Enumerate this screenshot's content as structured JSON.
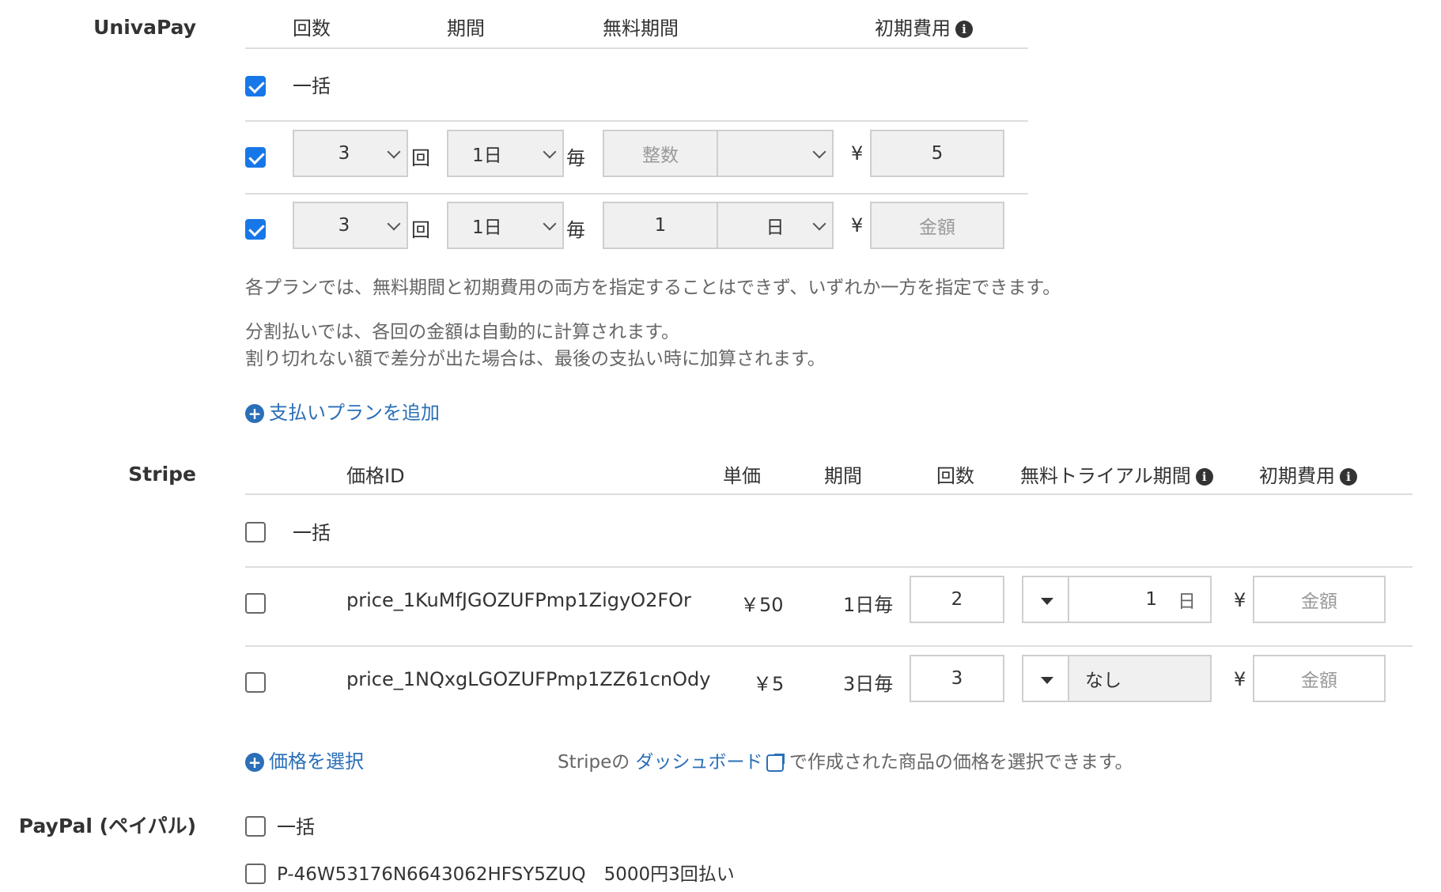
{
  "univapay": {
    "label": "UnivaPay",
    "headers": {
      "count": "回数",
      "period": "期間",
      "free_period": "無料期間",
      "initial_fee": "初期費用"
    },
    "lump_sum_label": "一括",
    "rows": [
      {
        "count": "3",
        "count_unit": "回",
        "period": "1日",
        "period_unit": "毎",
        "free_value_placeholder": "整数",
        "free_unit": "",
        "currency": "¥",
        "initial_fee": "5",
        "initial_placeholder": "金額"
      },
      {
        "count": "3",
        "count_unit": "回",
        "period": "1日",
        "period_unit": "毎",
        "free_value": "1",
        "free_unit": "日",
        "currency": "¥",
        "initial_fee": "",
        "initial_placeholder": "金額"
      }
    ],
    "note1": "各プランでは、無料期間と初期費用の両方を指定することはできず、いずれか一方を指定できます。",
    "note2": "分割払いでは、各回の金額は自動的に計算されます。",
    "note3": "割り切れない額で差分が出た場合は、最後の支払い時に加算されます。",
    "add_plan": "支払いプランを追加"
  },
  "stripe": {
    "label": "Stripe",
    "headers": {
      "price_id": "価格ID",
      "unit_price": "単価",
      "period": "期間",
      "count": "回数",
      "free_trial": "無料トライアル期間",
      "initial_fee": "初期費用"
    },
    "lump_sum_label": "一括",
    "rows": [
      {
        "price_id": "price_1KuMfJGOZUFPmp1ZigyO2FOr",
        "unit_price": "￥50",
        "period": "1日毎",
        "count": "2",
        "trial_value": "1",
        "trial_unit": "日",
        "currency": "¥",
        "initial_placeholder": "金額"
      },
      {
        "price_id": "price_1NQxgLGOZUFPmp1ZZ61cnOdy",
        "unit_price": "￥5",
        "period": "3日毎",
        "count": "3",
        "trial_value": "なし",
        "trial_unit": "",
        "currency": "¥",
        "initial_placeholder": "金額"
      }
    ],
    "select_price": "価格を選択",
    "dashboard_prefix": "Stripeの",
    "dashboard_link": "ダッシュボード",
    "dashboard_suffix": "で作成された商品の価格を選択できます。"
  },
  "paypal": {
    "label": "PayPal (ペイパル)",
    "lump_sum_label": "一括",
    "plan_label": "P-46W53176N6643062HFSY5ZUQ　5000円3回払い"
  }
}
